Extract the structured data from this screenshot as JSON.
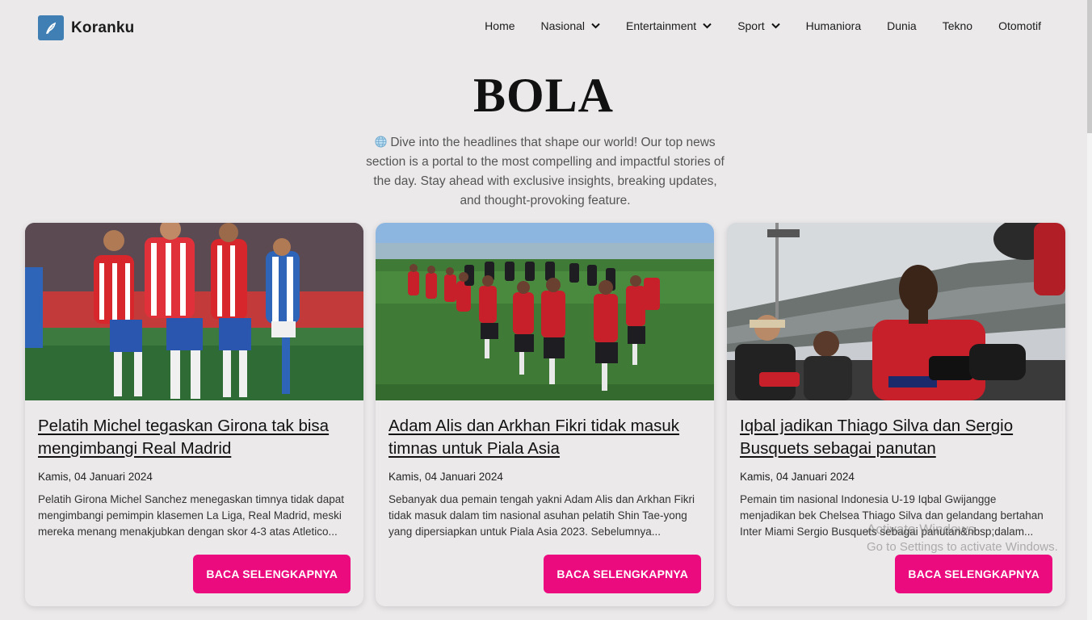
{
  "brand": {
    "name": "Koranku",
    "logo_icon": "feather-icon",
    "logo_color": "#3f7fb3"
  },
  "nav": {
    "items": [
      {
        "label": "Home",
        "dropdown": false
      },
      {
        "label": "Nasional",
        "dropdown": true
      },
      {
        "label": "Entertainment",
        "dropdown": true
      },
      {
        "label": "Sport",
        "dropdown": true
      },
      {
        "label": "Humaniora",
        "dropdown": false
      },
      {
        "label": "Dunia",
        "dropdown": false
      },
      {
        "label": "Tekno",
        "dropdown": false
      },
      {
        "label": "Otomotif",
        "dropdown": false
      }
    ]
  },
  "hero": {
    "title": "BOLA",
    "icon": "globe-icon",
    "description": "Dive into the headlines that shape our world! Our top news section is a portal to the most compelling and impactful stories of the day. Stay ahead with exclusive insights, breaking updates, and thought-provoking feature."
  },
  "cards": [
    {
      "title": "Pelatih Michel tegaskan Girona tak bisa mengimbangi Real Madrid",
      "date": "Kamis, 04 Januari 2024",
      "excerpt": "Pelatih Girona Michel Sanchez menegaskan timnya tidak dapat mengimbangi pemimpin klasemen La Liga, Real Madrid, meski mereka menang menakjubkan dengan skor 4-3 atas Atletico...",
      "button": "BACA SELENGKAPNYA",
      "image": "girona-players-celebrating-photo"
    },
    {
      "title": "Adam Alis dan Arkhan Fikri tidak masuk timnas untuk Piala Asia",
      "date": "Kamis, 04 Januari 2024",
      "excerpt": "Sebanyak dua pemain tengah yakni Adam Alis dan Arkhan Fikri tidak masuk dalam tim nasional asuhan pelatih Shin Tae-yong yang dipersiapkan untuk Piala Asia 2023. Sebelumnya...",
      "button": "BACA SELENGKAPNYA",
      "image": "timnas-training-huddle-photo"
    },
    {
      "title": "Iqbal jadikan Thiago Silva dan Sergio Busquets sebagai panutan",
      "date": "Kamis, 04 Januari 2024",
      "excerpt": "Pemain tim nasional Indonesia U-19 Iqbal Gwijangge menjadikan bek Chelsea Thiago Silva dan gelandang bertahan Inter Miami Sergio Busquets sebagai panutan&nbsp;dalam...",
      "button": "BACA SELENGKAPNYA",
      "image": "player-press-interview-photo"
    }
  ],
  "watermark": {
    "line1": "Activate Windows",
    "line2": "Go to Settings to activate Windows."
  },
  "colors": {
    "background": "#ebe9ea",
    "accent": "#ec0b7e",
    "text": "#111111"
  }
}
